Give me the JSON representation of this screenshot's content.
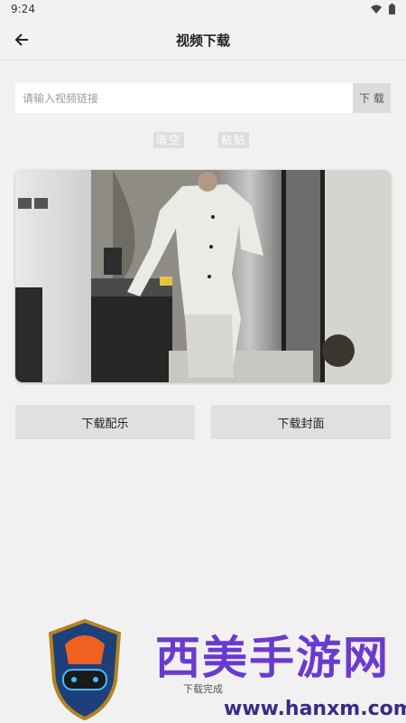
{
  "status_bar": {
    "time": "9:24"
  },
  "app_bar": {
    "title": "视频下载"
  },
  "url_input": {
    "placeholder": "请输入视频链接",
    "value": ""
  },
  "buttons": {
    "download": "下 载",
    "clear": "清空",
    "paste": "粘贴",
    "download_music": "下载配乐",
    "download_cover": "下载封面"
  },
  "status_message": "下载完成",
  "watermark": {
    "brand": "西美手游网",
    "url": "www.hanxm.com"
  },
  "colors": {
    "background": "#f1f1f1",
    "button": "#e0e0e0",
    "input": "#ffffff"
  }
}
